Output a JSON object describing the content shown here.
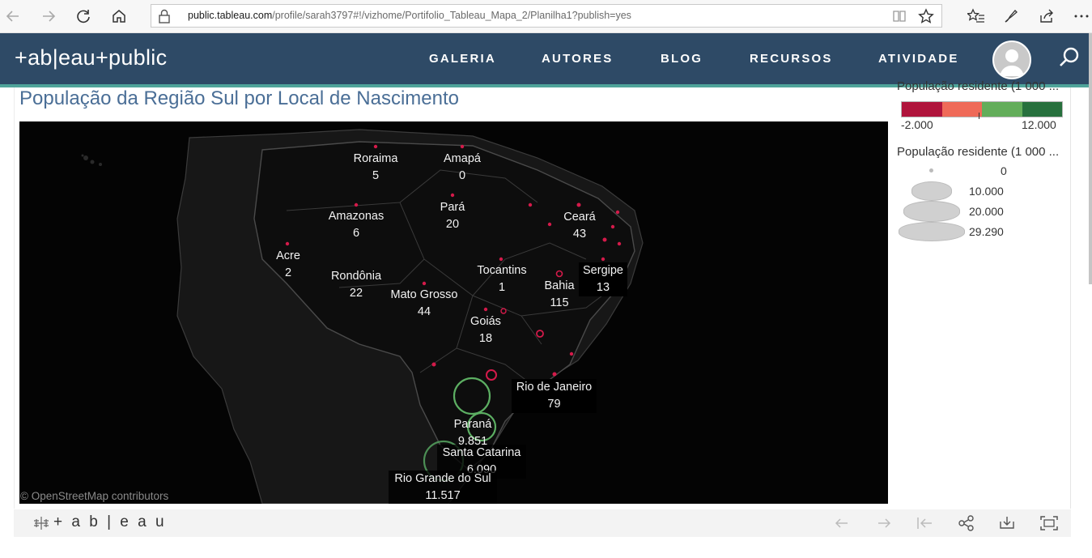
{
  "browser": {
    "url_domain": "public.tableau.com",
    "url_prefix": "",
    "url_rest": "/profile/sarah3797#!/vizhome/Portifolio_Tableau_Mapa_2/Planilha1?publish=yes"
  },
  "header": {
    "logo": "+ab|eau+public",
    "nav": [
      "GALERIA",
      "AUTORES",
      "BLOG",
      "RECURSOS",
      "ATIVIDADE"
    ]
  },
  "viz": {
    "title": "População da Região Sul por Local de Nascimento",
    "map_attribution": "© OpenStreetMap contributors",
    "states": [
      {
        "name": "Roraima",
        "value": "5"
      },
      {
        "name": "Amapá",
        "value": "0"
      },
      {
        "name": "Amazonas",
        "value": "6"
      },
      {
        "name": "Pará",
        "value": "20"
      },
      {
        "name": "Ceará",
        "value": "43"
      },
      {
        "name": "Acre",
        "value": "2"
      },
      {
        "name": "Rondônia",
        "value": "22"
      },
      {
        "name": "Tocantins",
        "value": "1"
      },
      {
        "name": "Sergipe",
        "value": "13"
      },
      {
        "name": "Bahia",
        "value": "115"
      },
      {
        "name": "Mato Grosso",
        "value": "44"
      },
      {
        "name": "Goiás",
        "value": "18"
      },
      {
        "name": "Rio de Janeiro",
        "value": "79"
      },
      {
        "name": "Paraná",
        "value": "9.851"
      },
      {
        "name": "Santa Catarina",
        "value": "6.090"
      },
      {
        "name": "Rio Grande do Sul",
        "value": "11.517"
      }
    ]
  },
  "legend": {
    "color_title": "População residente (1 000 ...",
    "color_min": "-2.000",
    "color_max": "12.000",
    "color_stops": [
      "#b0143c",
      "#ef6a58",
      "#63ad5a",
      "#27703d"
    ],
    "size_title": "População residente (1 000 ...",
    "size_values": [
      "0",
      "10.000",
      "20.000",
      "29.290"
    ]
  },
  "footer": {
    "logo": "+ a b | e a u"
  },
  "colors": {
    "nav_bg": "#2e4a66",
    "accent_line": "#4fa39a",
    "title": "#4a6e96",
    "marker_red": "#d41a4a",
    "marker_green": "#5cae62"
  }
}
